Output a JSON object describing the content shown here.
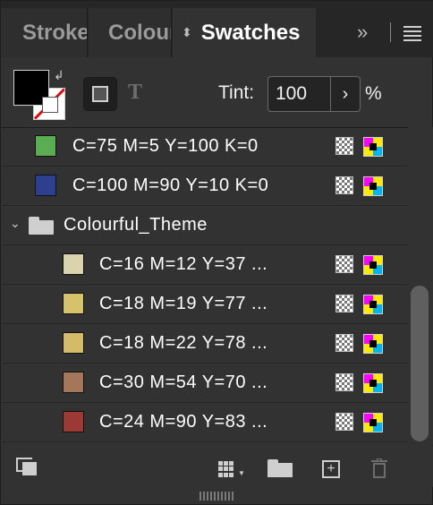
{
  "tabs": [
    {
      "label": "Stroke",
      "active": false
    },
    {
      "label": "Colour",
      "active": false
    },
    {
      "label": "Swatches",
      "active": true
    }
  ],
  "tab_overflow": "»",
  "header": {
    "tint_label": "Tint:",
    "tint_value": "100",
    "tint_stepper": "›",
    "tint_unit": "%",
    "text_format": "T",
    "swap_arrow": "↲"
  },
  "swatches": [
    {
      "label": "C=75 M=5 Y=100 K=0",
      "color": "#5aad52"
    },
    {
      "label": "C=100 M=90 Y=10 K=0",
      "color": "#2d3f8e"
    }
  ],
  "group": {
    "name": "Colourful_Theme",
    "chevron": "⌄",
    "items": [
      {
        "label": "C=16 M=12 Y=37 ...",
        "color": "#d9d3ae"
      },
      {
        "label": "C=18 M=19 Y=77 ...",
        "color": "#d6c26a"
      },
      {
        "label": "C=18 M=22 Y=78 ...",
        "color": "#d4bb69"
      },
      {
        "label": "C=30 M=54 Y=70 ...",
        "color": "#a5775a"
      },
      {
        "label": "C=24 M=90 Y=83 ...",
        "color": "#9b3a34"
      }
    ]
  },
  "footer": {
    "new_swatch_symbol": "+"
  },
  "colors": {
    "panel_bg": "#323232",
    "tab_bar_bg": "#262626"
  }
}
